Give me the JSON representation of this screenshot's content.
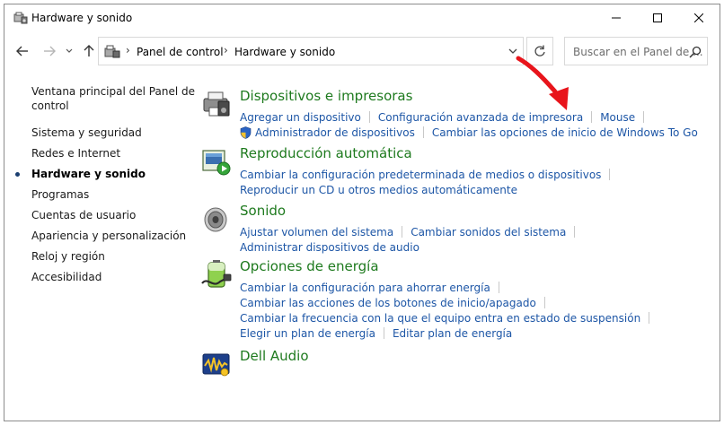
{
  "window": {
    "title": "Hardware y sonido",
    "controls": {
      "minimize": "minimize-icon",
      "maximize": "maximize-icon",
      "close": "close-icon"
    }
  },
  "address_bar": {
    "segments": [
      "Panel de control",
      "Hardware y sonido"
    ],
    "separator": "›",
    "search_placeholder": "Buscar en el Panel de ..."
  },
  "sidebar": {
    "items": [
      {
        "label": "Ventana principal del Panel de",
        "label2": "control"
      },
      {
        "label": "Sistema y seguridad"
      },
      {
        "label": "Redes e Internet"
      },
      {
        "label": "Hardware y sonido",
        "active": true
      },
      {
        "label": "Programas"
      },
      {
        "label": "Cuentas de usuario"
      },
      {
        "label": "Apariencia y personalización"
      },
      {
        "label": "Reloj y región"
      },
      {
        "label": "Accesibilidad"
      }
    ]
  },
  "sections": {
    "devices": {
      "title": "Dispositivos e impresoras",
      "links": [
        [
          "Agregar un dispositivo",
          "Configuración avanzada de impresora",
          "Mouse"
        ],
        [
          "Administrador de dispositivos",
          "Cambiar las opciones de inicio de Windows To Go"
        ]
      ]
    },
    "autoplay": {
      "title": "Reproducción automática",
      "links": [
        [
          "Cambiar la configuración predeterminada de medios o dispositivos"
        ],
        [
          "Reproducir un CD u otros medios automáticamente"
        ]
      ]
    },
    "sound": {
      "title": "Sonido",
      "links": [
        [
          "Ajustar volumen del sistema",
          "Cambiar sonidos del sistema"
        ],
        [
          "Administrar dispositivos de audio"
        ]
      ]
    },
    "power": {
      "title": "Opciones de energía",
      "links": [
        [
          "Cambiar la configuración para ahorrar energía"
        ],
        [
          "Cambiar las acciones de los botones de inicio/apagado"
        ],
        [
          "Cambiar la frecuencia con la que el equipo entra en estado de suspensión"
        ],
        [
          "Elegir un plan de energía",
          "Editar plan de energía"
        ]
      ]
    },
    "dell_audio": {
      "title": "Dell Audio"
    }
  },
  "colors": {
    "section_title": "#1e7a1e",
    "link": "#1d56a6",
    "annotation_arrow": "#e8141b"
  }
}
